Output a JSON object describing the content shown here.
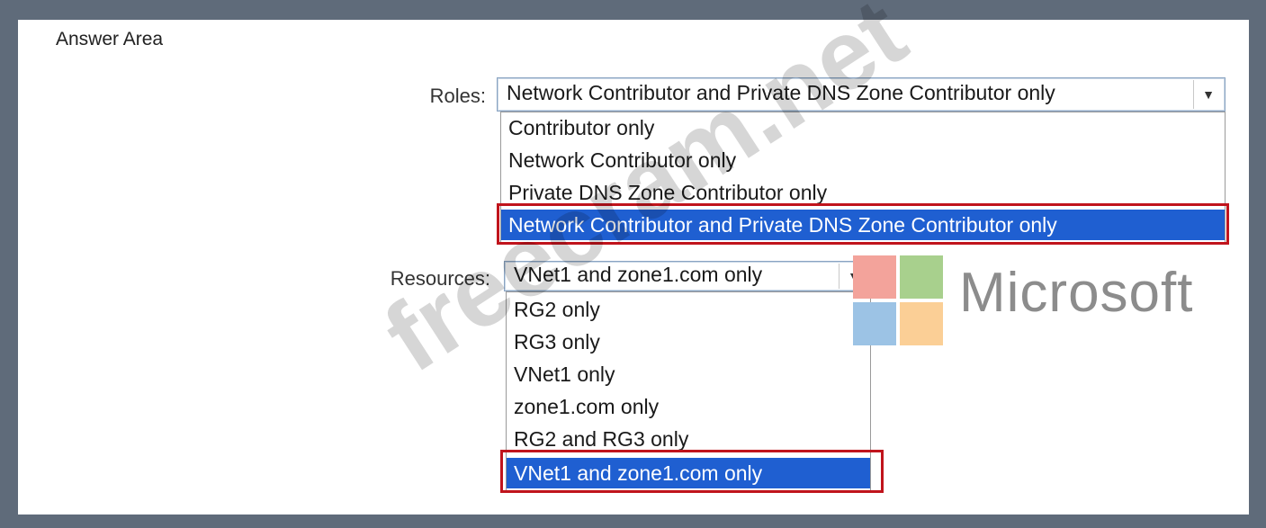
{
  "answer_area": {
    "title": "Answer Area"
  },
  "roles": {
    "label": "Roles:",
    "selected": "Network Contributor and Private DNS Zone Contributor only",
    "options": [
      "Contributor only",
      "Network Contributor only",
      "Private DNS Zone Contributor only",
      "Network Contributor and Private DNS Zone Contributor only"
    ]
  },
  "resources": {
    "label": "Resources:",
    "selected": "VNet1 and zone1.com only",
    "options": [
      "RG2 only",
      "RG3 only",
      "VNet1 only",
      "zone1.com only",
      "RG2 and RG3 only",
      "VNet1 and zone1.com only"
    ]
  },
  "dropdown_arrow_icon": "chevron-down",
  "logo": {
    "text": "Microsoft",
    "colors": [
      "#f3a39b",
      "#a8d08d",
      "#9cc3e5",
      "#fbcf96"
    ]
  },
  "watermark": {
    "text": "freecram.net"
  },
  "colors": {
    "selection": "#1f5fd1",
    "highlight_border": "#c0141c"
  }
}
